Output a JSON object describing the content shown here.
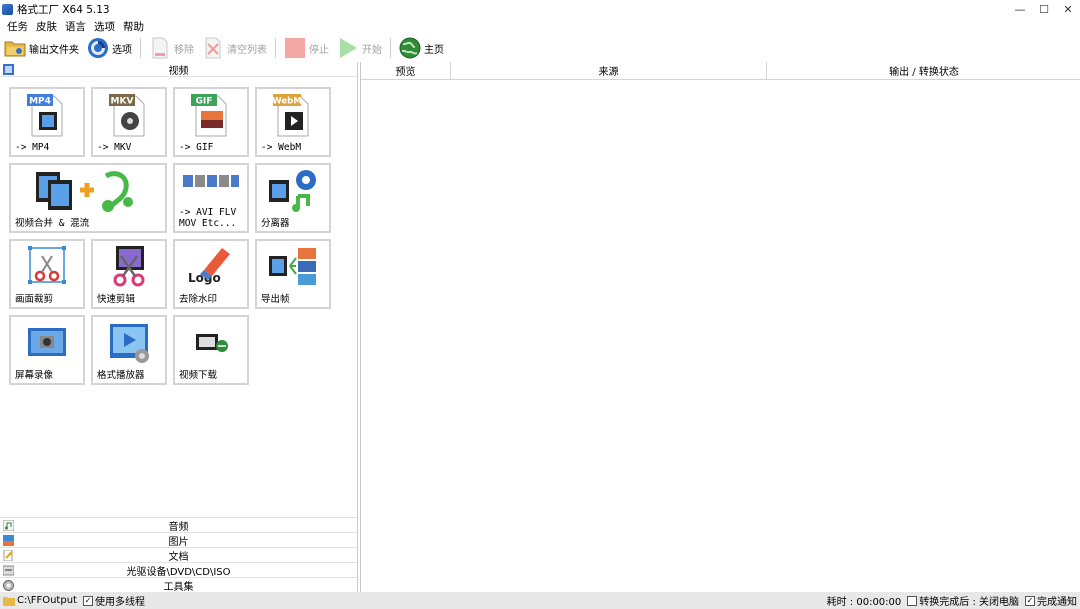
{
  "window": {
    "title": "格式工厂 X64 5.13",
    "minimize": "—",
    "maximize": "☐",
    "close": "✕"
  },
  "menu": [
    "任务",
    "皮肤",
    "语言",
    "选项",
    "帮助"
  ],
  "toolbar": {
    "output_folder": "输出文件夹",
    "options": "选项",
    "remove": "移除",
    "clear_list": "清空列表",
    "stop": "停止",
    "start": "开始",
    "home": "主页"
  },
  "left": {
    "video_header": "视频",
    "tiles": [
      {
        "label": "-> MP4",
        "badge": "MP4",
        "badge_color": "#3f7fd9"
      },
      {
        "label": "-> MKV",
        "badge": "MKV",
        "badge_color": "#7a6a4a"
      },
      {
        "label": "-> GIF",
        "badge": "GIF",
        "badge_color": "#3da35a"
      },
      {
        "label": "-> WebM",
        "badge": "WebM",
        "badge_color": "#e0a23a"
      },
      {
        "label": "视频合并 & 混流"
      },
      {
        "label": "-> AVI FLV\nMOV Etc..."
      },
      {
        "label": "分离器"
      },
      {
        "label": "画面裁剪"
      },
      {
        "label": "快速剪辑"
      },
      {
        "label": "去除水印",
        "logo_text": "Logo"
      },
      {
        "label": "导出帧"
      },
      {
        "label": "屏幕录像"
      },
      {
        "label": "格式播放器"
      },
      {
        "label": "视频下载"
      }
    ],
    "categories": [
      "音频",
      "图片",
      "文档",
      "光驱设备\\DVD\\CD\\ISO",
      "工具集"
    ]
  },
  "table": {
    "columns": [
      "预览",
      "来源",
      "输出 / 转换状态"
    ]
  },
  "status": {
    "output_path": "C:\\FFOutput",
    "multithread": "使用多线程",
    "elapsed": "耗时 : 00:00:00",
    "after_done": "转换完成后 : 关闭电脑",
    "notify": "完成通知",
    "check": "✓"
  },
  "colors": {
    "accent_blue": "#2b6cc4",
    "status_bg": "#e8e8e8",
    "tile_border": "#d4d4d4"
  }
}
